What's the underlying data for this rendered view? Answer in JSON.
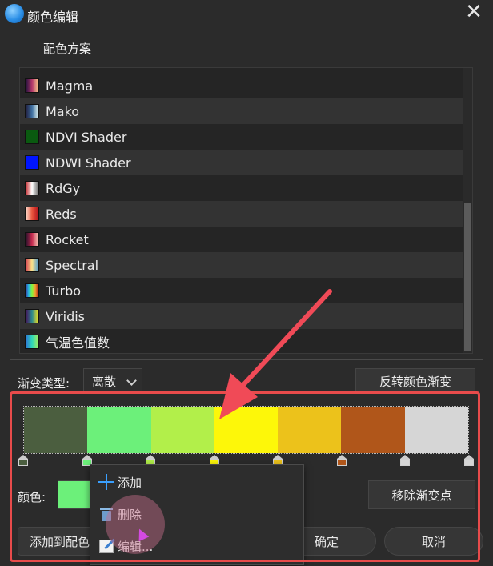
{
  "window": {
    "title": "颜色编辑",
    "close_symbol": "✕"
  },
  "scheme_group": {
    "title": "配色方案",
    "items": [
      {
        "label": "Magma",
        "gradient": "linear-gradient(90deg,#1a0f3a,#b3376b,#fcc98c)"
      },
      {
        "label": "Mako",
        "gradient": "linear-gradient(90deg,#1f1a3a,#3e6fa0,#dff2ef)"
      },
      {
        "label": "NDVI Shader",
        "gradient": "linear-gradient(90deg,#0a5a10,#0a5a10)"
      },
      {
        "label": "NDWI Shader",
        "gradient": "linear-gradient(90deg,#0015ff,#0015ff)"
      },
      {
        "label": "RdGy",
        "gradient": "linear-gradient(90deg,#c4262b,#ffffff,#6b6b6b)"
      },
      {
        "label": "Reds",
        "gradient": "linear-gradient(90deg,#fde3d4,#e9553d,#b3121c)"
      },
      {
        "label": "Rocket",
        "gradient": "linear-gradient(90deg,#1e0f28,#c72a4f,#f7c8b5)"
      },
      {
        "label": "Spectral",
        "gradient": "linear-gradient(90deg,#d43d4f,#fbe38a,#4f9ad0)"
      },
      {
        "label": "Turbo",
        "gradient": "linear-gradient(90deg,#3b2aa0,#26c0e0,#84f43c,#f2a22f,#b01a14)"
      },
      {
        "label": "Viridis",
        "gradient": "linear-gradient(90deg,#450c58,#2c8a8e,#f4e21e)"
      },
      {
        "label": "气温色值数",
        "gradient": "linear-gradient(90deg,#2e6fd8,#2fd8b8,#a0f060)"
      }
    ]
  },
  "gradient_type": {
    "label": "渐变类型:",
    "value": "离散"
  },
  "reverse_button": "反转颜色渐变",
  "gradient_bar": {
    "colors": [
      "#4b5e3f",
      "#6cf07a",
      "#b2ef4a",
      "#fdf709",
      "#ecc21b",
      "#b0561a",
      "#d6d6d6"
    ]
  },
  "stops": [
    {
      "color": "#4b5e3f",
      "pos": 0
    },
    {
      "color": "#6cf07a",
      "pos": 0.1429
    },
    {
      "color": "#b2ef4a",
      "pos": 0.2857
    },
    {
      "color": "#fdf709",
      "pos": 0.4286
    },
    {
      "color": "#ecc21b",
      "pos": 0.5714
    },
    {
      "color": "#b0561a",
      "pos": 0.7143
    },
    {
      "color": "#d6d6d6",
      "pos": 0.8571
    },
    {
      "color": "#d6d6d6",
      "pos": 1
    }
  ],
  "color_field": {
    "label": "颜色:",
    "value": "#6cf07a"
  },
  "remove_stop_button": "移除渐变点",
  "add_to_scheme_button": "添加到配色",
  "ok_button": "确定",
  "cancel_button": "取消",
  "context_menu": {
    "items": [
      {
        "label": "添加",
        "icon": "plus-icon"
      },
      {
        "label": "删除",
        "icon": "trash-icon"
      },
      {
        "label": "编辑...",
        "icon": "edit-icon"
      }
    ]
  },
  "annotation": {
    "arrow_color": "#f04a57",
    "frame_color": "#e84b4b"
  }
}
